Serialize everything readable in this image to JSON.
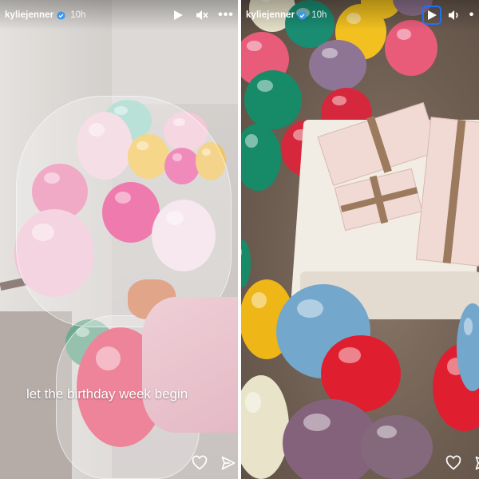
{
  "left_story": {
    "username": "kyliejenner",
    "time": "10h",
    "caption": "let the birthday week begin",
    "controls": {
      "play": "play-icon",
      "sound": "sound-muted-icon",
      "more": "•••"
    },
    "actions": {
      "like": "heart-icon",
      "share": "send-icon"
    }
  },
  "right_story": {
    "username": "kyliejenner",
    "time": "10h",
    "controls": {
      "play": "play-icon",
      "sound": "sound-on-icon",
      "more": "•"
    },
    "actions": {
      "like": "heart-icon",
      "share": "send-icon"
    }
  },
  "colors": {
    "verified": "#3897f0",
    "focus_outline": "#1f6fff",
    "text": "#ffffff"
  }
}
